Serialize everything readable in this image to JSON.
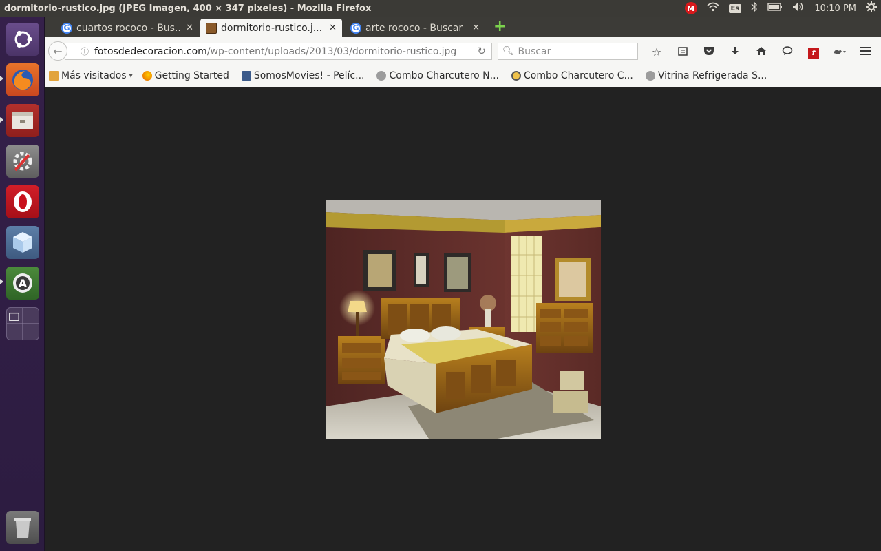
{
  "window": {
    "title": "dormitorio-rustico.jpg (JPEG Imagen, 400 × 347 pixeles) - Mozilla Firefox"
  },
  "tray": {
    "mega_icon": "M",
    "keyboard_layout": "Es",
    "time": "10:10 PM"
  },
  "launcher": {
    "items": [
      {
        "name": "ubuntu-dash-icon"
      },
      {
        "name": "firefox-icon"
      },
      {
        "name": "files-icon"
      },
      {
        "name": "system-settings-icon"
      },
      {
        "name": "opera-icon"
      },
      {
        "name": "cube-app-icon"
      },
      {
        "name": "software-updater-icon"
      },
      {
        "name": "workspace-switcher-icon"
      },
      {
        "name": "trash-icon"
      }
    ]
  },
  "tabs": [
    {
      "label": "cuartos rococo - Bus...",
      "favicon": "google-icon",
      "active": false
    },
    {
      "label": "dormitorio-rustico.j...",
      "favicon": "image-icon",
      "active": true
    },
    {
      "label": "arte rococo - Buscar ...",
      "favicon": "google-icon",
      "active": false
    }
  ],
  "navbar": {
    "url_host": "fotosdedecoracion.com",
    "url_path": "/wp-content/uploads/2013/03/dormitorio-rustico.jpg",
    "search_placeholder": "Buscar"
  },
  "bookmarks": [
    {
      "label": "Más visitados",
      "icon": "folder-icon",
      "dropdown": true
    },
    {
      "label": "Getting Started",
      "icon": "firefox-icon"
    },
    {
      "label": "SomosMovies! - Pelíc...",
      "icon": "film-icon"
    },
    {
      "label": "Combo Charcutero N...",
      "icon": "globe-icon"
    },
    {
      "label": "Combo Charcutero C...",
      "icon": "combo-icon"
    },
    {
      "label": "Vitrina Refrigerada S...",
      "icon": "globe-icon"
    }
  ],
  "colors": {
    "content_bg": "#222222",
    "panel_bg": "#3b3a36",
    "launcher_bg": "#35204a",
    "accent_red": "#d7191c"
  }
}
